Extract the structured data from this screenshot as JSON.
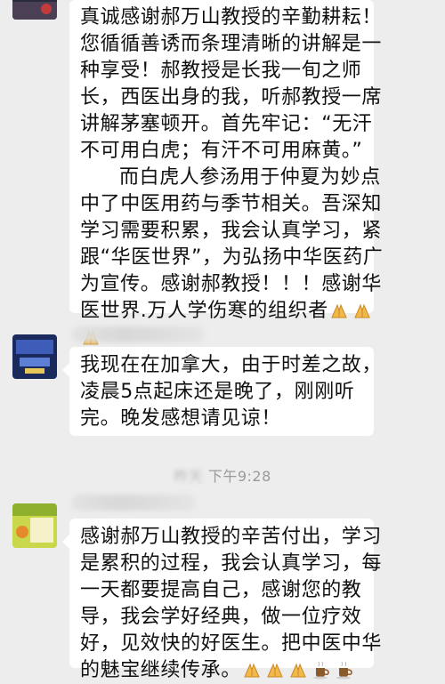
{
  "messages": [
    {
      "lines": [
        "真诚感谢郝万山教授的辛勤耕耘！",
        "您循循善诱而条理清晰的讲解是一",
        "种享受！郝教授是长我一旬之师",
        "长，西医出身的我，听郝教授一席",
        "讲解茅塞顿开。首先牢记：“无汗",
        "不可用白虎；有汗不可用麻黄。”",
        "而白虎人参汤用于仲夏为妙点",
        "中了中医用药与季节相关。吾深知",
        "学习需要积累，我会认真学习，紧",
        "跟“华医世界”，为弘扬中华医药广",
        "为宣传。感谢郝教授！！！感谢华",
        "医世界.万人学伤寒的组织者"
      ],
      "emojis": [
        "folded-hands-emoji",
        "folded-hands-emoji",
        "folded-hands-emoji"
      ]
    },
    {
      "lines": [
        "我现在在加拿大，由于时差之故，",
        "凌晨5点起床还是晚了，刚刚听",
        "完。晚发感想请见谅！"
      ]
    },
    {
      "lines": [
        "感谢郝万山教授的辛苦付出，学习",
        "是累积的过程，我会认真学习，每",
        "一天都要提高自己，感谢您的教",
        "导，我会学好经典，做一位疗效",
        "好，见效快的好医生。把中医中华",
        "的魅宝继续传承。"
      ],
      "emojis": [
        "folded-hands-emoji",
        "folded-hands-emoji",
        "folded-hands-emoji",
        "coffee-cup-emoji",
        "coffee-cup-emoji"
      ]
    }
  ],
  "timestamp": {
    "blurred_part": "昨天",
    "time": "下午9:28"
  },
  "colors": {
    "background": "#ededed",
    "bubble": "#ffffff",
    "text": "#111111",
    "timestamp": "#9a9a9a"
  }
}
